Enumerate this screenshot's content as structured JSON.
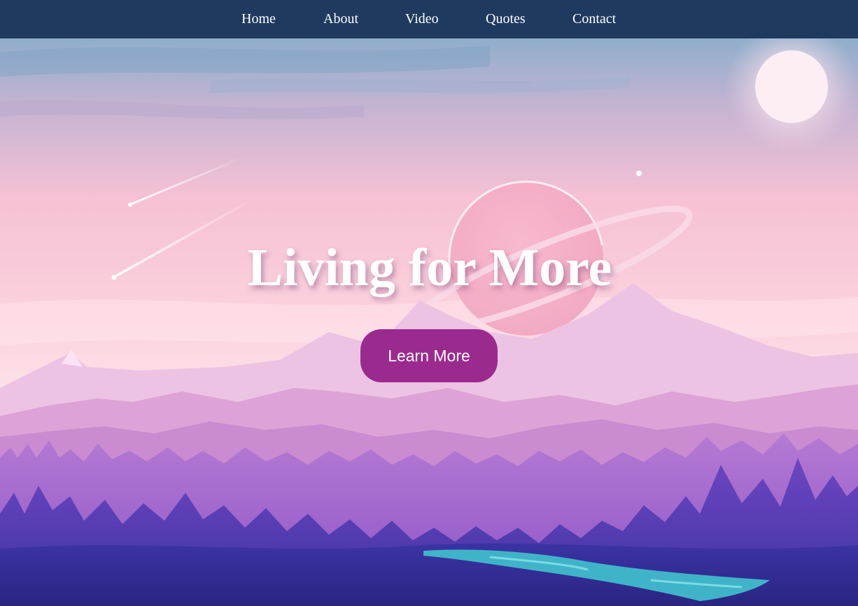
{
  "nav": {
    "items": [
      {
        "label": "Home"
      },
      {
        "label": "About"
      },
      {
        "label": "Video"
      },
      {
        "label": "Quotes"
      },
      {
        "label": "Contact"
      }
    ],
    "background": "#1f3a5f"
  },
  "hero": {
    "title": "Living for More",
    "button_label": "Learn More",
    "button_color": "#9b2a8e",
    "illustration": {
      "description_icons": [
        "sun-icon",
        "ringed-planet-icon",
        "shooting-star-icon",
        "crescent-moon-icon",
        "star-icon"
      ],
      "sky_colors": [
        "#8fb0cc",
        "#f7c0d3",
        "#fde2ea"
      ],
      "mountain_colors": [
        "#e9b6dc",
        "#d99ad3",
        "#c77cc9"
      ],
      "forest_colors": [
        "#9a5cc8",
        "#6a3cb8",
        "#3b2f9a"
      ],
      "river_color": "#3fb4c9"
    }
  }
}
